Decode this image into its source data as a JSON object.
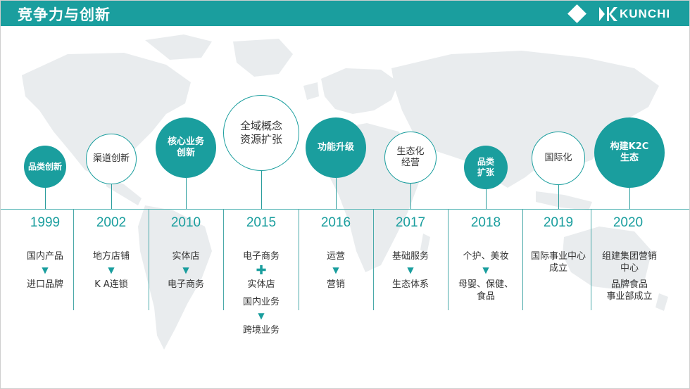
{
  "header": {
    "title": "竞争力与创新",
    "logo_text": "KUNCHI"
  },
  "milestones": [
    {
      "year": "1999",
      "circle_label": "品类创新",
      "items": [
        "国内产品",
        "进口品牌"
      ],
      "connectors": [
        "arrow"
      ]
    },
    {
      "year": "2002",
      "circle_label": "渠道创新",
      "items": [
        "地方店铺",
        "K A连锁"
      ],
      "connectors": [
        "arrow"
      ]
    },
    {
      "year": "2010",
      "circle_label": "核心业务\n创新",
      "items": [
        "实体店",
        "电子商务"
      ],
      "connectors": [
        "arrow"
      ]
    },
    {
      "year": "2015",
      "circle_label": "全域概念\n资源扩张",
      "items": [
        "电子商务",
        "实体店",
        "国内业务",
        "跨境业务"
      ],
      "connectors": [
        "plus",
        "arrow"
      ]
    },
    {
      "year": "2016",
      "circle_label": "功能升级",
      "items": [
        "运营",
        "营销"
      ],
      "connectors": [
        "arrow"
      ]
    },
    {
      "year": "2017",
      "circle_label": "生态化\n经营",
      "items": [
        "基础服务",
        "生态体系"
      ],
      "connectors": [
        "arrow"
      ]
    },
    {
      "year": "2018",
      "circle_label": "品类\n扩张",
      "items": [
        "个护、美妆",
        "母婴、保健、\n食品"
      ],
      "connectors": [
        "arrow"
      ]
    },
    {
      "year": "2019",
      "circle_label": "国际化",
      "items": [
        "国际事业中心\n成立"
      ],
      "connectors": []
    },
    {
      "year": "2020",
      "circle_label": "构建K2C\n生态",
      "items": [
        "组建集团营销\n中心",
        "品牌食品\n事业部成立"
      ],
      "connectors": []
    }
  ],
  "symbols": {
    "arrow": "▼",
    "plus": "✚"
  },
  "colors": {
    "accent": "#1a9e9e",
    "map": "#e9ecee",
    "text": "#333333"
  }
}
